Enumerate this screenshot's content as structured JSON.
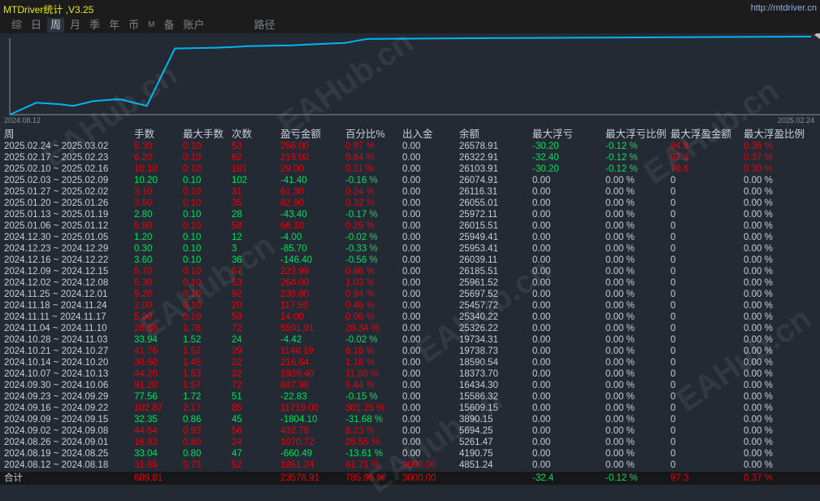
{
  "app": {
    "title": "MTDriver统计 ,V3.25",
    "url": "http://mtdriver.cn"
  },
  "tabs": [
    {
      "label": "综"
    },
    {
      "label": "日"
    },
    {
      "label": "周",
      "active": true
    },
    {
      "label": "月"
    },
    {
      "label": "季"
    },
    {
      "label": "年"
    },
    {
      "label": "币"
    },
    {
      "label": "M"
    },
    {
      "label": "备"
    },
    {
      "label": "账户"
    },
    {
      "label": "路径"
    }
  ],
  "watermark": "EAHub.cn",
  "colors": {
    "line": "#00b4f0",
    "red": "#e8000b",
    "green": "#00e060"
  },
  "chart_data": {
    "type": "line",
    "title": "",
    "x_start_label": "2024.08.12",
    "x_end_label": "2025.02.24",
    "ylabel": "",
    "y_unit": "relative level (0-100)",
    "x": [
      0,
      3.3,
      6.4,
      7.9,
      10.4,
      12.9,
      13.9,
      17.1,
      20.6,
      25.8,
      28,
      29.6,
      35.1,
      37.2,
      41.8,
      44.6,
      59.5,
      100
    ],
    "values": [
      0,
      15,
      13,
      11,
      17,
      19,
      19,
      11,
      83,
      84,
      85,
      86,
      87,
      88,
      90,
      95,
      96,
      98
    ]
  },
  "table": {
    "headers": [
      "周",
      "手数",
      "最大手数",
      "次数",
      "盈亏金额",
      "百分比%",
      "出入金",
      "余额",
      "最大浮亏",
      "最大浮亏比例",
      "最大浮盈金额",
      "最大浮盈比例"
    ],
    "rows": [
      [
        "2025.02.24 ~ 2025.03.02",
        "5.30",
        "0.10",
        "53",
        "256.00",
        "0.97 %",
        "0.00",
        "26578.91",
        "-30.20",
        "-0.12 %",
        "94.8",
        "0.36 %"
      ],
      [
        "2025.02.17 ~ 2025.02.23",
        "6.20",
        "0.10",
        "62",
        "219.00",
        "0.84 %",
        "0.00",
        "26322.91",
        "-32.40",
        "-0.12 %",
        "97.3",
        "0.37 %"
      ],
      [
        "2025.02.10 ~ 2025.02.16",
        "10.10",
        "0.10",
        "101",
        "29.00",
        "0.11 %",
        "0.00",
        "26103.91",
        "-30.20",
        "-0.12 %",
        "78.6",
        "0.30 %"
      ],
      [
        "2025.02.03 ~ 2025.02.09",
        "10.20",
        "0.10",
        "102",
        "-41.40",
        "-0.16 %",
        "0.00",
        "26074.91",
        "0.00",
        "0.00 %",
        "0",
        "0.00 %"
      ],
      [
        "2025.01.27 ~ 2025.02.02",
        "3.10",
        "0.10",
        "31",
        "61.30",
        "0.24 %",
        "0.00",
        "26116.31",
        "0.00",
        "0.00 %",
        "0",
        "0.00 %"
      ],
      [
        "2025.01.20 ~ 2025.01.26",
        "3.50",
        "0.10",
        "35",
        "82.90",
        "0.32 %",
        "0.00",
        "26055.01",
        "0.00",
        "0.00 %",
        "0",
        "0.00 %"
      ],
      [
        "2025.01.13 ~ 2025.01.19",
        "2.80",
        "0.10",
        "28",
        "-43.40",
        "-0.17 %",
        "0.00",
        "25972.11",
        "0.00",
        "0.00 %",
        "0",
        "0.00 %"
      ],
      [
        "2025.01.06 ~ 2025.01.12",
        "5.80",
        "0.10",
        "58",
        "66.10",
        "0.25 %",
        "0.00",
        "26015.51",
        "0.00",
        "0.00 %",
        "0",
        "0.00 %"
      ],
      [
        "2024.12.30 ~ 2025.01.05",
        "1.20",
        "0.10",
        "12",
        "-4.00",
        "-0.02 %",
        "0.00",
        "25949.41",
        "0.00",
        "0.00 %",
        "0",
        "0.00 %"
      ],
      [
        "2024.12.23 ~ 2024.12.29",
        "0.30",
        "0.10",
        "3",
        "-85.70",
        "-0.33 %",
        "0.00",
        "25953.41",
        "0.00",
        "0.00 %",
        "0",
        "0.00 %"
      ],
      [
        "2024.12.16 ~ 2024.12.22",
        "3.60",
        "0.10",
        "36",
        "-146.40",
        "-0.56 %",
        "0.00",
        "26039.11",
        "0.00",
        "0.00 %",
        "0",
        "0.00 %"
      ],
      [
        "2024.12.09 ~ 2024.12.15",
        "5.70",
        "0.10",
        "57",
        "223.99",
        "0.86 %",
        "0.00",
        "26185.51",
        "0.00",
        "0.00 %",
        "0",
        "0.00 %"
      ],
      [
        "2024.12.02 ~ 2024.12.08",
        "5.30",
        "0.10",
        "53",
        "264.00",
        "1.03 %",
        "0.00",
        "25961.52",
        "0.00",
        "0.00 %",
        "0",
        "0.00 %"
      ],
      [
        "2024.11.25 ~ 2024.12.01",
        "9.20",
        "0.10",
        "92",
        "239.80",
        "0.94 %",
        "0.00",
        "25697.52",
        "0.00",
        "0.00 %",
        "0",
        "0.00 %"
      ],
      [
        "2024.11.18 ~ 2024.11.24",
        "2.00",
        "0.10",
        "20",
        "117.50",
        "0.46 %",
        "0.00",
        "25457.72",
        "0.00",
        "0.00 %",
        "0",
        "0.00 %"
      ],
      [
        "2024.11.11 ~ 2024.11.17",
        "5.90",
        "0.10",
        "59",
        "14.00",
        "0.06 %",
        "0.00",
        "25340.22",
        "0.00",
        "0.00 %",
        "0",
        "0.00 %"
      ],
      [
        "2024.11.04 ~ 2024.11.10",
        "28.88",
        "1.78",
        "72",
        "5591.91",
        "28.34 %",
        "0.00",
        "25326.22",
        "0.00",
        "0.00 %",
        "0",
        "0.00 %"
      ],
      [
        "2024.10.28 ~ 2024.11.03",
        "33.94",
        "1.52",
        "24",
        "-4.42",
        "-0.02 %",
        "0.00",
        "19734.31",
        "0.00",
        "0.00 %",
        "0",
        "0.00 %"
      ],
      [
        "2024.10.21 ~ 2024.10.27",
        "41.76",
        "1.52",
        "29",
        "1148.19",
        "6.18 %",
        "0.00",
        "19738.73",
        "0.00",
        "0.00 %",
        "0",
        "0.00 %"
      ],
      [
        "2024.10.14 ~ 2024.10.20",
        "30.60",
        "1.45",
        "22",
        "216.84",
        "1.18 %",
        "0.00",
        "18590.54",
        "0.00",
        "0.00 %",
        "0",
        "0.00 %"
      ],
      [
        "2024.10.07 ~ 2024.10.13",
        "44.20",
        "1.53",
        "32",
        "1939.40",
        "11.80 %",
        "0.00",
        "18373.70",
        "0.00",
        "0.00 %",
        "0",
        "0.00 %"
      ],
      [
        "2024.09.30 ~ 2024.10.06",
        "91.20",
        "1.57",
        "72",
        "847.98",
        "5.44 %",
        "0.00",
        "16434.30",
        "0.00",
        "0.00 %",
        "0",
        "0.00 %"
      ],
      [
        "2024.09.23 ~ 2024.09.29",
        "77.56",
        "1.72",
        "51",
        "-22.83",
        "-0.15 %",
        "0.00",
        "15586.32",
        "0.00",
        "0.00 %",
        "0",
        "0.00 %"
      ],
      [
        "2024.09.16 ~ 2024.09.22",
        "102.87",
        "2.17",
        "85",
        "11719.00",
        "301.25 %",
        "0.00",
        "15609.15",
        "0.00",
        "0.00 %",
        "0",
        "0.00 %"
      ],
      [
        "2024.09.09 ~ 2024.09.15",
        "32.35",
        "0.86",
        "45",
        "-1804.10",
        "-31.68 %",
        "0.00",
        "3890.15",
        "0.00",
        "0.00 %",
        "0",
        "0.00 %"
      ],
      [
        "2024.09.02 ~ 2024.09.08",
        "44.64",
        "0.93",
        "56",
        "432.78",
        "8.23 %",
        "0.00",
        "5694.25",
        "0.00",
        "0.00 %",
        "0",
        "0.00 %"
      ],
      [
        "2024.08.26 ~ 2024.09.01",
        "16.92",
        "0.80",
        "24",
        "1070.72",
        "25.55 %",
        "0.00",
        "5261.47",
        "0.00",
        "0.00 %",
        "0",
        "0.00 %"
      ],
      [
        "2024.08.19 ~ 2024.08.25",
        "33.04",
        "0.80",
        "47",
        "-660.49",
        "-13.61 %",
        "0.00",
        "4190.75",
        "0.00",
        "0.00 %",
        "0",
        "0.00 %"
      ],
      [
        "2024.08.12 ~ 2024.08.18",
        "31.65",
        "0.73",
        "52",
        "1851.24",
        "61.71 %",
        "3000.00",
        "4851.24",
        "0.00",
        "0.00 %",
        "0",
        "0.00 %"
      ]
    ],
    "total": [
      "合计",
      "689.81",
      "",
      "",
      "23578.91",
      "785.96 %",
      "3000.00",
      "",
      "-32.4",
      "-0.12 %",
      "97.3",
      "0.37 %"
    ]
  }
}
